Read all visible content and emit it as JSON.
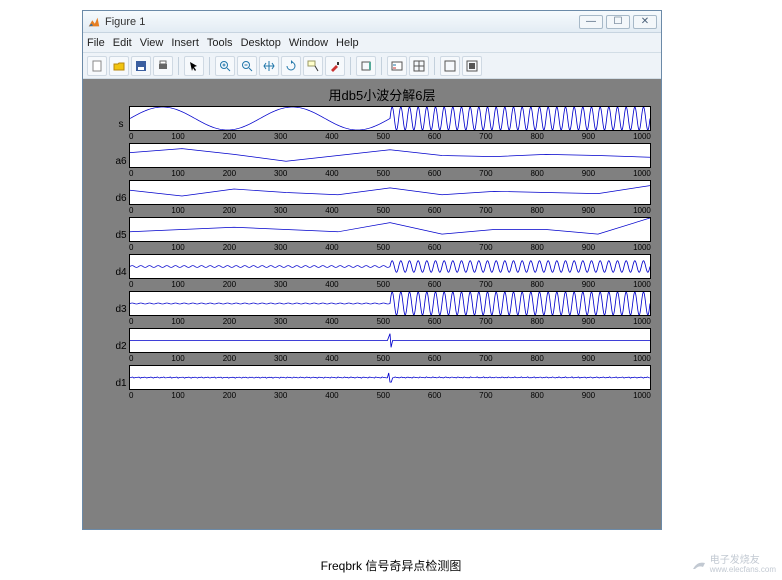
{
  "window": {
    "title": "Figure 1",
    "min_glyph": "—",
    "max_glyph": "☐",
    "close_glyph": "✕"
  },
  "menu": [
    "File",
    "Edit",
    "View",
    "Insert",
    "Tools",
    "Desktop",
    "Window",
    "Help"
  ],
  "toolbar_icons": [
    "new",
    "open",
    "save",
    "print",
    "arrow",
    "zoom-in",
    "zoom-out",
    "pan",
    "rotate",
    "cursor",
    "brush",
    "region",
    "inspect",
    "grid",
    "link",
    "copy"
  ],
  "caption": "Freqbrk 信号奇异点检测图",
  "watermark_cn": "电子发烧友",
  "watermark_url": "www.elecfans.com",
  "chart_data": {
    "title": "用db5小波分解6层",
    "xlim": [
      0,
      1000
    ],
    "xticks": [
      0,
      100,
      200,
      300,
      400,
      500,
      600,
      700,
      800,
      900,
      1000
    ],
    "subplots": [
      {
        "label": "s",
        "ylim": [
          -1,
          1
        ],
        "yticks": [
          -1,
          0,
          1
        ],
        "type": "composite-sine",
        "note": "low-freq sine 0-500, approx 2 periods; high-freq sine 500-1000, approx 30 periods",
        "segments": [
          {
            "x0": 0,
            "x1": 500,
            "freq": 2,
            "amp": 1.0,
            "offset": 0
          },
          {
            "x0": 500,
            "x1": 1000,
            "freq": 30,
            "amp": 1.0,
            "offset": 0
          }
        ]
      },
      {
        "label": "a6",
        "ylim": [
          -2,
          2
        ],
        "yticks": [
          -2,
          0,
          2
        ],
        "type": "approx-curve",
        "points_x": [
          0,
          100,
          200,
          300,
          400,
          500,
          600,
          700,
          800,
          900,
          1000
        ],
        "points_y": [
          0.5,
          1.2,
          0.2,
          -1.0,
          0.0,
          1.0,
          0.0,
          -0.2,
          0.2,
          0.0,
          -0.3
        ]
      },
      {
        "label": "d6",
        "ylim": [
          -1,
          1
        ],
        "yticks": [
          -1,
          0,
          1
        ],
        "type": "approx-curve",
        "points_x": [
          0,
          100,
          200,
          300,
          400,
          500,
          600,
          700,
          800,
          900,
          1000
        ],
        "points_y": [
          0.2,
          -0.3,
          0.3,
          0.0,
          -0.2,
          0.4,
          -0.2,
          0.1,
          0.0,
          -0.1,
          0.6
        ]
      },
      {
        "label": "d5",
        "ylim": [
          -0.5,
          0.5
        ],
        "yticks": [
          -0.5,
          0,
          0.5
        ],
        "type": "approx-curve",
        "points_x": [
          0,
          100,
          200,
          300,
          400,
          500,
          600,
          700,
          800,
          900,
          1000
        ],
        "points_y": [
          -0.1,
          0.0,
          0.1,
          0.0,
          -0.1,
          0.3,
          -0.2,
          0.0,
          0.0,
          -0.2,
          0.5
        ]
      },
      {
        "label": "d4",
        "ylim": [
          -2,
          2
        ],
        "yticks": [
          -2,
          0,
          2
        ],
        "type": "composite-sine",
        "note": "small noise 0-500, high-freq ~amp1 500-1000",
        "segments": [
          {
            "x0": 0,
            "x1": 500,
            "freq": 30,
            "amp": 0.15,
            "offset": 0
          },
          {
            "x0": 500,
            "x1": 1000,
            "freq": 30,
            "amp": 1.0,
            "offset": 0
          }
        ]
      },
      {
        "label": "d3",
        "ylim": [
          -0.5,
          0.5
        ],
        "yticks": [
          -0.5,
          0,
          0.5
        ],
        "type": "composite-sine",
        "note": "near-zero 0-500, high-freq amp~0.5 500-1000",
        "segments": [
          {
            "x0": 0,
            "x1": 500,
            "freq": 30,
            "amp": 0.02,
            "offset": 0
          },
          {
            "x0": 500,
            "x1": 1000,
            "freq": 30,
            "amp": 0.5,
            "offset": 0
          }
        ]
      },
      {
        "label": "d2",
        "ylim": [
          -0.5,
          0.5
        ],
        "yticks": [
          -0.5,
          0,
          0.5
        ],
        "type": "spike-line",
        "baseline": 0,
        "spike_x": 500,
        "spike_amp": 0.3
      },
      {
        "label": "d1",
        "ylim": [
          -0.5,
          0.5
        ],
        "yticks": [
          -0.5,
          0,
          0.5
        ],
        "type": "flat-noise",
        "baseline": 0,
        "amp": 0.05,
        "spike_x": 500,
        "spike_amp": 0.2
      }
    ]
  }
}
